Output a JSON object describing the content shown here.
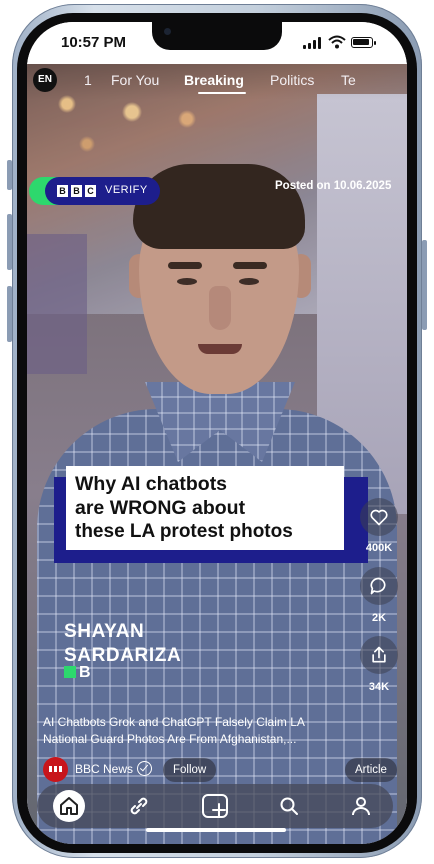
{
  "status_bar": {
    "time": "10:57 PM"
  },
  "top_nav": {
    "language": "EN",
    "tabs": [
      {
        "label": "1"
      },
      {
        "label": "For You"
      },
      {
        "label": "Breaking"
      },
      {
        "label": "Politics"
      },
      {
        "label": "Te"
      }
    ],
    "active_tab": "Breaking"
  },
  "badge": {
    "label": "VERIFY",
    "letters": [
      "B",
      "B",
      "C"
    ]
  },
  "posted": "Posted on 10.06.2025",
  "headline": {
    "line1": "Why AI chatbots",
    "line2": "are WRONG about",
    "line3": "these LA protest photos"
  },
  "presenter": {
    "first": "SHAYAN",
    "last": "SARDARIZA",
    "suffix": "B"
  },
  "actions": {
    "likes": "400K",
    "comments": "2K",
    "shares": "34K"
  },
  "caption": "AI Chatbots Grok and ChatGPT Falsely Claim LA National Guard Photos Are From Afghanistan,...",
  "source": {
    "name": "BBC News",
    "follow_label": "Follow",
    "article_label": "Article"
  },
  "bottom_nav": [
    "home-icon",
    "link-icon",
    "plus-icon",
    "search-icon",
    "profile-icon"
  ],
  "colors": {
    "bbc_blue": "#1d1e8c",
    "verify_green": "#2dd86d",
    "bbc_red": "#c8151b"
  }
}
